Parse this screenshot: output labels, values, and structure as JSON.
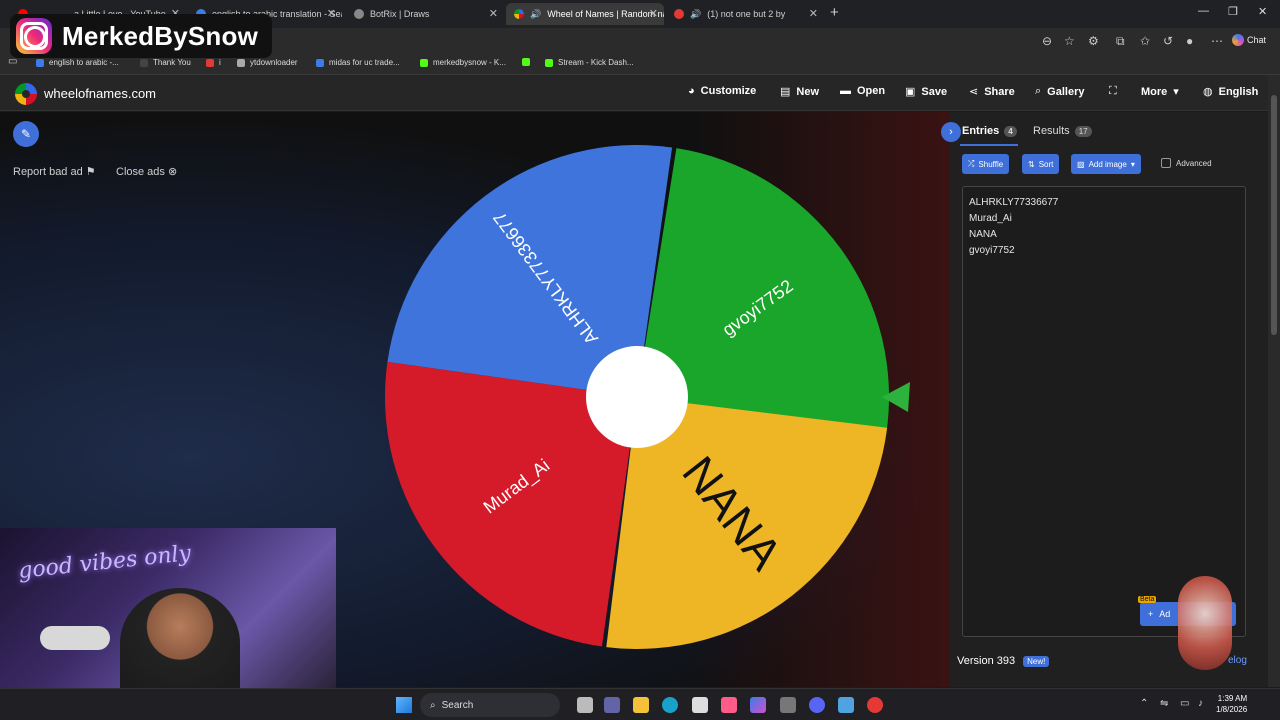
{
  "browser": {
    "tabs": [
      {
        "label": "a Little Love - YouTube",
        "fav": "#ff0000"
      },
      {
        "label": "english to arabic translation - Sear",
        "fav": "#3c7ce8"
      },
      {
        "label": "BotRix | Draws",
        "fav": "#888888"
      },
      {
        "label": "Wheel of Names | Random na",
        "fav": "#3369e8",
        "active": true
      },
      {
        "label": "(1) not one but 2 by",
        "fav": "#e53935"
      }
    ],
    "chat_label": "Chat"
  },
  "bookmarks": [
    {
      "label": "english to arabic -...",
      "color": "#3c7ce8"
    },
    {
      "label": "Thank You",
      "color": "#444444"
    },
    {
      "label": "i",
      "color": "#e53935"
    },
    {
      "label": "ytdownloader",
      "color": "#aaaaaa"
    },
    {
      "label": "midas for uc trade...",
      "color": "#3c7ce8"
    },
    {
      "label": "merkedbysnow - K...",
      "color": "#53fc18"
    },
    {
      "label": "",
      "color": "#53fc18"
    },
    {
      "label": "Stream - Kick Dash...",
      "color": "#53fc18"
    }
  ],
  "overlay": {
    "instagram_name": "MerkedBySnow"
  },
  "header": {
    "site_title": "wheelofnames.com",
    "menu": [
      {
        "label": "Customize",
        "icon": "palette-icon",
        "glyph": "🎨"
      },
      {
        "label": "New",
        "icon": "file-icon",
        "glyph": "📄"
      },
      {
        "label": "Open",
        "icon": "folder-icon",
        "glyph": "📂"
      },
      {
        "label": "Save",
        "icon": "save-icon",
        "glyph": "💾"
      },
      {
        "label": "Share",
        "icon": "share-icon",
        "glyph": "⤴"
      },
      {
        "label": "Gallery",
        "icon": "search-icon",
        "glyph": "🔍"
      },
      {
        "label": "",
        "icon": "fullscreen-icon",
        "glyph": "⛶"
      },
      {
        "label": "More",
        "icon": "chevron-down-icon",
        "glyph": "▾"
      },
      {
        "label": "English",
        "icon": "globe-icon",
        "glyph": "🌐"
      }
    ]
  },
  "ads": {
    "report": "Report bad ad",
    "close": "Close ads"
  },
  "wheel": {
    "segments": [
      {
        "name": "ALHRKLY77336677",
        "color": "#3f74dd"
      },
      {
        "name": "gvoyi7752",
        "color": "#1aa52b"
      },
      {
        "name": "NANA",
        "color": "#eeb524"
      },
      {
        "name": "Murad_Ai",
        "color": "#d51a2a"
      }
    ]
  },
  "panel": {
    "entries_tab": "Entries",
    "entries_count": "4",
    "results_tab": "Results",
    "results_count": "17",
    "shuffle": "Shuffle",
    "sort": "Sort",
    "add_image": "Add image",
    "advanced": "Advanced",
    "entries": [
      "ALHRKLY77336677",
      "Murad_Ai",
      "NANA",
      "gvoyi7752"
    ],
    "version": "Version 393",
    "new_badge": "New!",
    "changelog": "elog",
    "beta": "Beta",
    "add_label": "Ad"
  },
  "webcam": {
    "neon_text": "good vibes only"
  },
  "taskbar": {
    "search": "Search",
    "time": "1:39 AM",
    "date": "1/8/2026"
  }
}
